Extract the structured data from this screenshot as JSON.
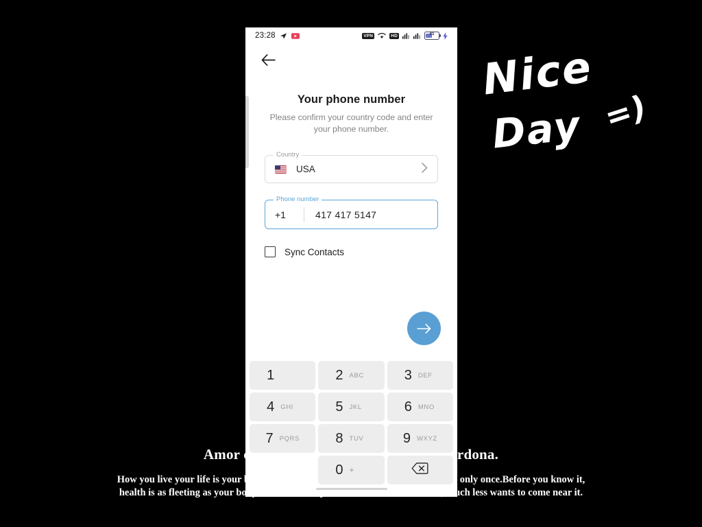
{
  "background": {
    "quote_line": "Amor con amor se paga, amado amar perdona.",
    "sub_text": "How you live your life is your business, but remember, our bodies are given to us only once.Before you know it,  health is as fleeting as your body there comes a point when no one looks at it,  much less wants to come near it."
  },
  "handwriting": {
    "line1": "Nice",
    "line2": "Day",
    "smiley": "=)"
  },
  "phone": {
    "statusbar": {
      "time": "23:28",
      "telegram_icon": "send-icon",
      "youtube_icon": "youtube-icon",
      "vpn_label": "VPN",
      "wifi_icon": "wifi-icon",
      "hd_label": "HD",
      "signal1_icon": "signal-bars-icon",
      "signal2_icon": "signal-bars-icon",
      "battery_level": "41",
      "charging_icon": "bolt-icon"
    },
    "appbar": {
      "back_icon": "back-arrow-icon"
    },
    "screen": {
      "title": "Your phone number",
      "subtitle": "Please confirm your country code and enter your phone number.",
      "country": {
        "label": "Country",
        "value": "USA",
        "flag_icon": "usa-flag-icon",
        "chevron_icon": "chevron-right-icon"
      },
      "phone_number": {
        "label": "Phone number",
        "dial_code": "+1",
        "value": "417 417 5147",
        "placeholder": "Phone number",
        "accent_color": "#5aa5d8"
      },
      "sync_contacts": {
        "label": "Sync Contacts",
        "checked": false
      },
      "submit": {
        "icon": "arrow-right-icon",
        "color": "#5a9fd4"
      }
    },
    "keypad": {
      "rows": [
        [
          {
            "num": "1",
            "sub": ""
          },
          {
            "num": "2",
            "sub": "ABC"
          },
          {
            "num": "3",
            "sub": "DEF"
          }
        ],
        [
          {
            "num": "4",
            "sub": "GHI"
          },
          {
            "num": "5",
            "sub": "JKL"
          },
          {
            "num": "6",
            "sub": "MNO"
          }
        ],
        [
          {
            "num": "7",
            "sub": "PQRS"
          },
          {
            "num": "8",
            "sub": "TUV"
          },
          {
            "num": "9",
            "sub": "WXYZ"
          }
        ]
      ],
      "zero": {
        "num": "0",
        "sub": "+"
      },
      "backspace_icon": "backspace-icon"
    }
  }
}
